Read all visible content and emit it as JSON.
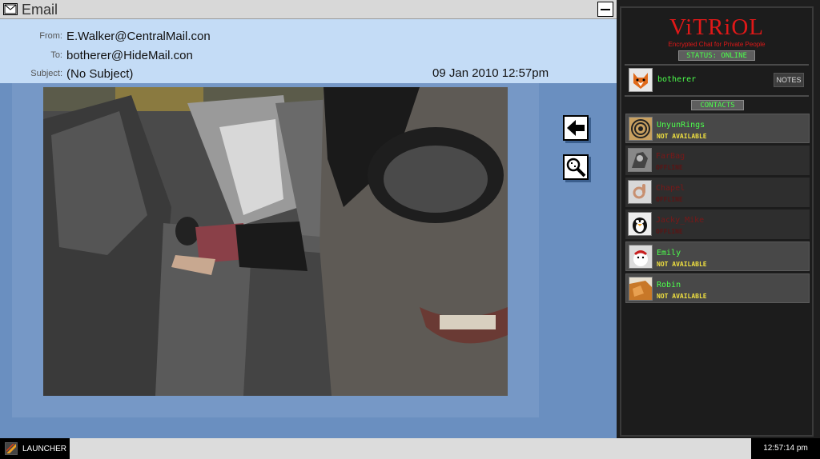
{
  "email": {
    "window_title": "Email",
    "from_label": "From:",
    "from": "E.Walker@CentralMail.con",
    "to_label": "To:",
    "to": "botherer@HideMail.con",
    "subject_label": "Subject:",
    "subject": "(No Subject)",
    "date": "09 Jan 2010 12:57pm",
    "icons": [
      "email-icon",
      "minimize-icon",
      "back-arrow-icon",
      "magnify-icon"
    ]
  },
  "chat": {
    "app_name": "ViTRiOL",
    "tagline": "Encrypted Chat for Private People",
    "status": "STATUS: ONLINE",
    "username": "botherer",
    "notes_label": "NOTES",
    "contacts_header": "CONTACTS",
    "contacts": [
      {
        "name": "UnyunRings",
        "status": "NOT AVAILABLE",
        "online": true
      },
      {
        "name": "FarBag",
        "status": "OFFLINE",
        "online": false
      },
      {
        "name": "Chapel",
        "status": "OFFLINE",
        "online": false
      },
      {
        "name": "Jacky_Mike",
        "status": "OFFLINE",
        "online": false
      },
      {
        "name": "Emily",
        "status": "NOT AVAILABLE",
        "online": true
      },
      {
        "name": "Robin",
        "status": "NOT AVAILABLE",
        "online": true
      }
    ],
    "colors": {
      "online_name": "#4cff4c",
      "available_status": "#f0e040",
      "offline": "#7a1818",
      "logo": "#e01818"
    }
  },
  "taskbar": {
    "launcher_label": "LAUNCHER",
    "clock": "12:57:14 pm"
  }
}
